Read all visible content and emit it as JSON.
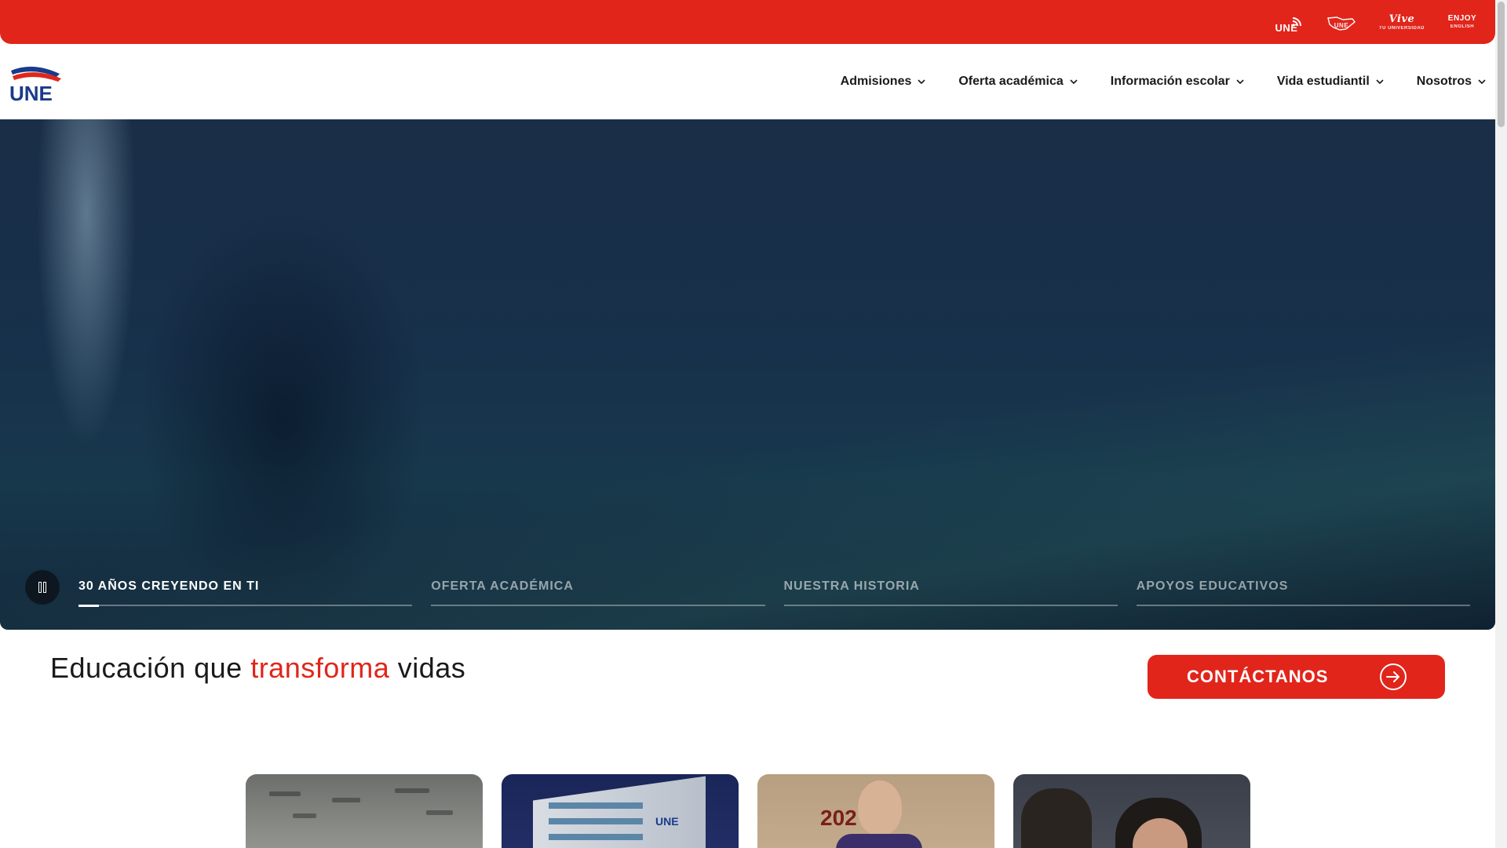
{
  "topbar": {
    "brands": [
      {
        "name": "une-en-linea",
        "text": "UNE",
        "sub": ""
      },
      {
        "name": "une-map",
        "text": "UNE",
        "sub": ""
      },
      {
        "name": "vive-tu-universidad",
        "text": "Vive",
        "sub": "TU UNIVERSIDAD"
      },
      {
        "name": "enjoy-english",
        "text": "ENJOY",
        "sub": "ENGLISH"
      }
    ]
  },
  "logo": {
    "text": "UNE"
  },
  "nav": {
    "items": [
      {
        "label": "Admisiones"
      },
      {
        "label": "Oferta académica"
      },
      {
        "label": "Información escolar"
      },
      {
        "label": "Vida estudiantil"
      },
      {
        "label": "Nosotros"
      }
    ]
  },
  "hero": {
    "slides": [
      {
        "label": "30 AÑOS CREYENDO EN TI",
        "active": true,
        "progress": 0.06
      },
      {
        "label": "OFERTA ACADÉMICA",
        "active": false,
        "progress": 0
      },
      {
        "label": "NUESTRA HISTORIA",
        "active": false,
        "progress": 0
      },
      {
        "label": "APOYOS EDUCATIVOS",
        "active": false,
        "progress": 0
      }
    ]
  },
  "tagline": {
    "part1": "Educación que ",
    "accent": "transforma",
    "part2": " vidas"
  },
  "cta": {
    "label": "CONTÁCTANOS"
  },
  "cards": {
    "card2_sign": "UNE",
    "card3_year": "202"
  },
  "colors": {
    "brand_red": "#e1251b",
    "brand_blue": "#1a3a8a",
    "text": "#1a1a1a"
  }
}
